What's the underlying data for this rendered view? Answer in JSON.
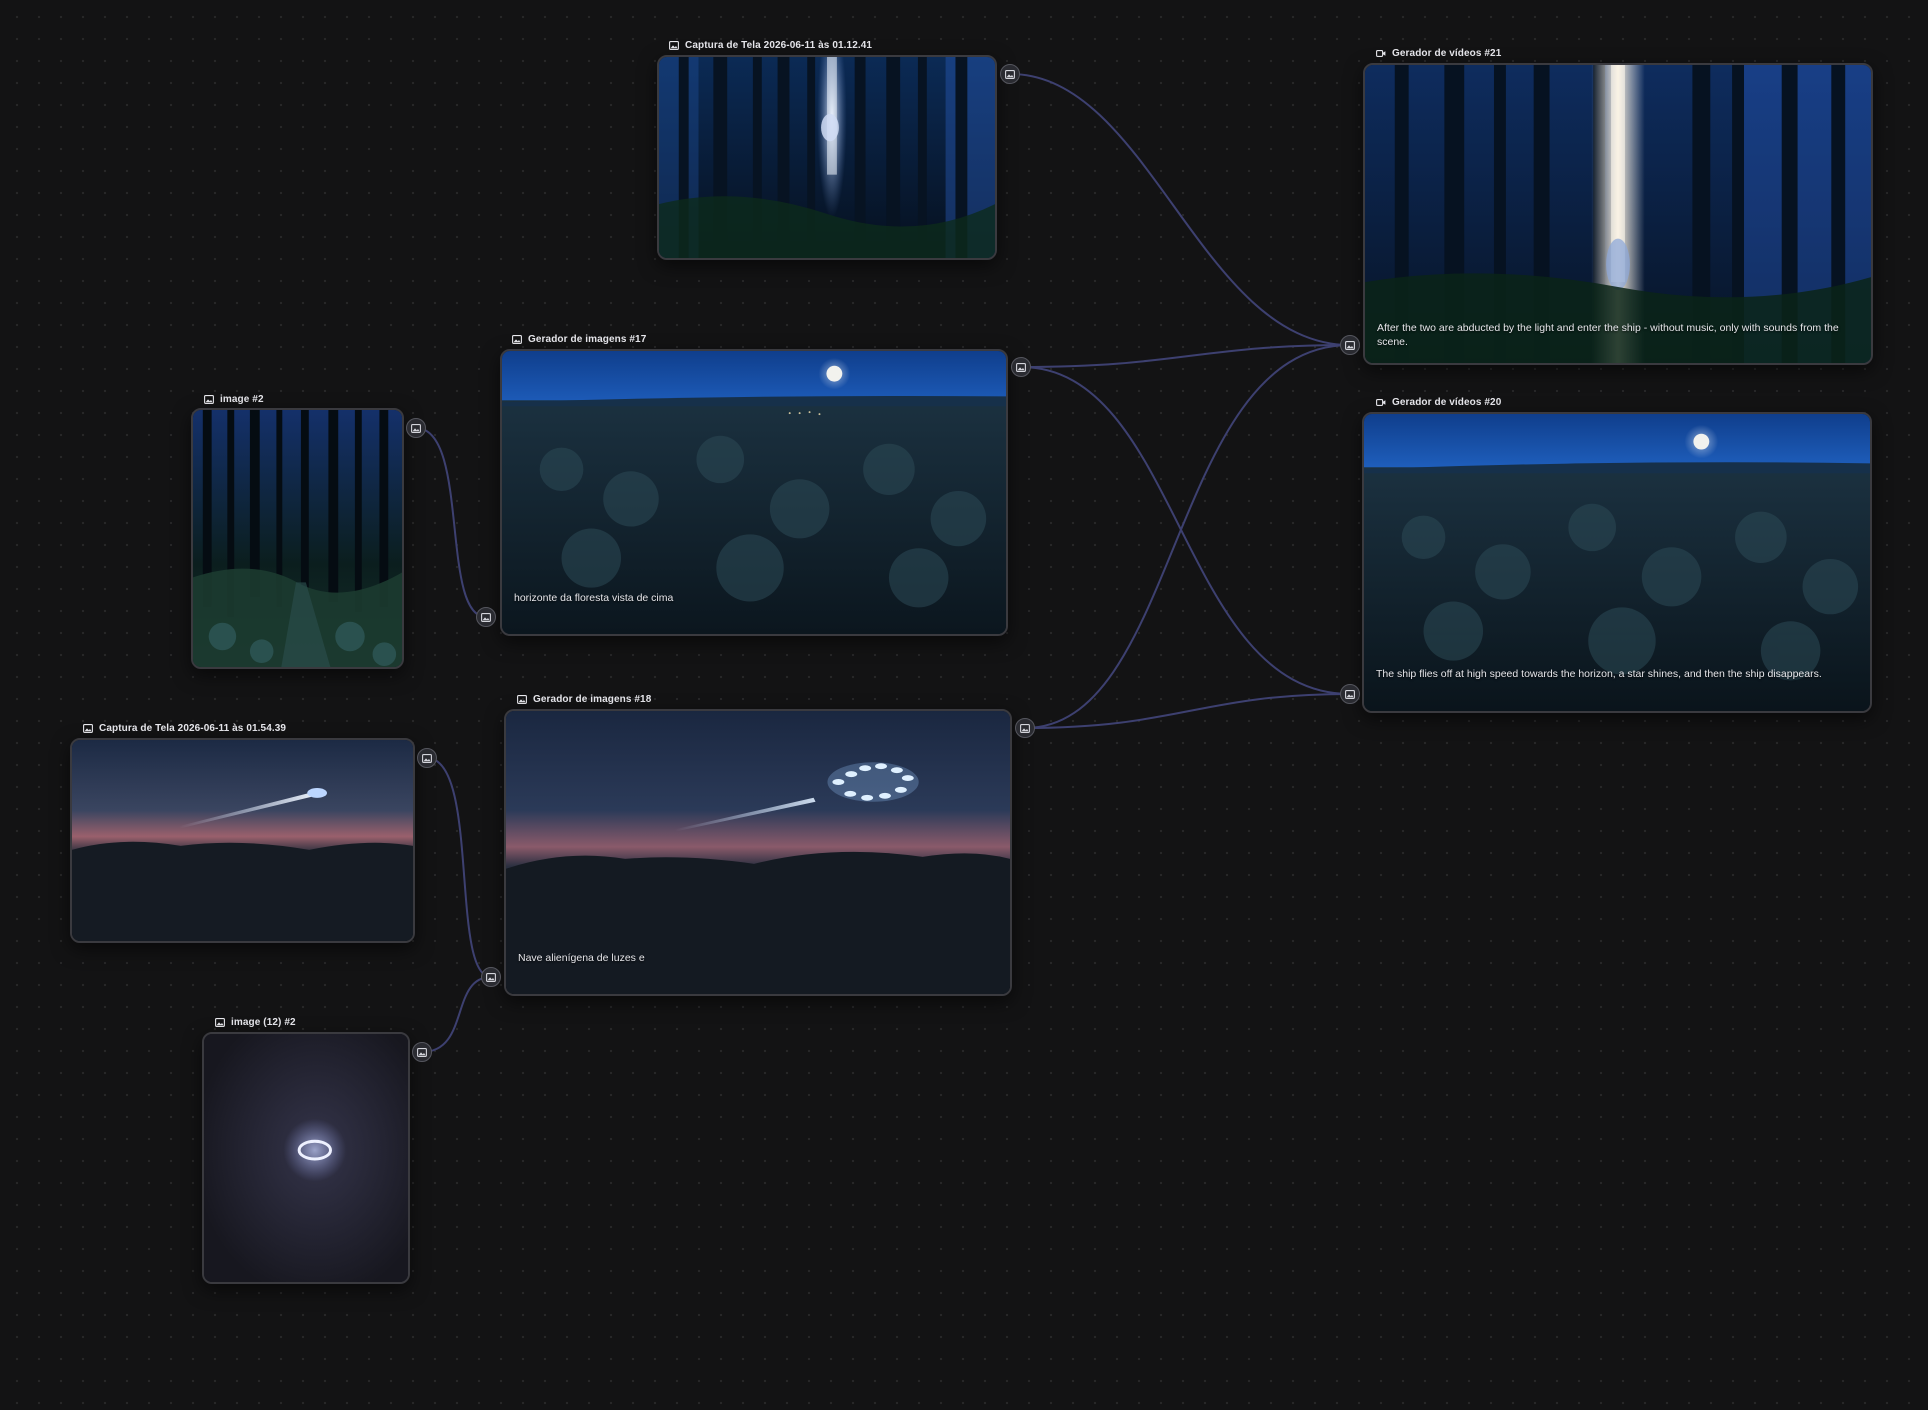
{
  "colors": {
    "background": "#131314",
    "wire": "#3d4070",
    "node_border": "#3a3a3f",
    "port_fill": "#2a2b31"
  },
  "nodes": {
    "capture1": {
      "title": "Captura de Tela 2026-06-11 às 01.12.41",
      "icon": "image-icon"
    },
    "video21": {
      "title": "Gerador de vídeos #21",
      "icon": "video-camera-icon",
      "prompt": "After the two are abducted by the light and enter the ship - without music, only with sounds from the scene."
    },
    "img17": {
      "title": "Gerador de imagens #17",
      "icon": "image-icon",
      "prompt": "horizonte da  floresta vista de cima"
    },
    "image2": {
      "title": "image #2",
      "icon": "image-icon"
    },
    "video20": {
      "title": "Gerador de vídeos #20",
      "icon": "video-camera-icon",
      "prompt": "The ship flies off at high speed towards the horizon, a star shines, and then the ship disappears."
    },
    "capture2": {
      "title": "Captura de Tela 2026-06-11 às 01.54.39",
      "icon": "image-icon"
    },
    "img18": {
      "title": "Gerador de imagens #18",
      "icon": "image-icon",
      "prompt": "Nave alienígena de luzes e"
    },
    "image12": {
      "title": "image (12) #2",
      "icon": "image-icon"
    }
  }
}
